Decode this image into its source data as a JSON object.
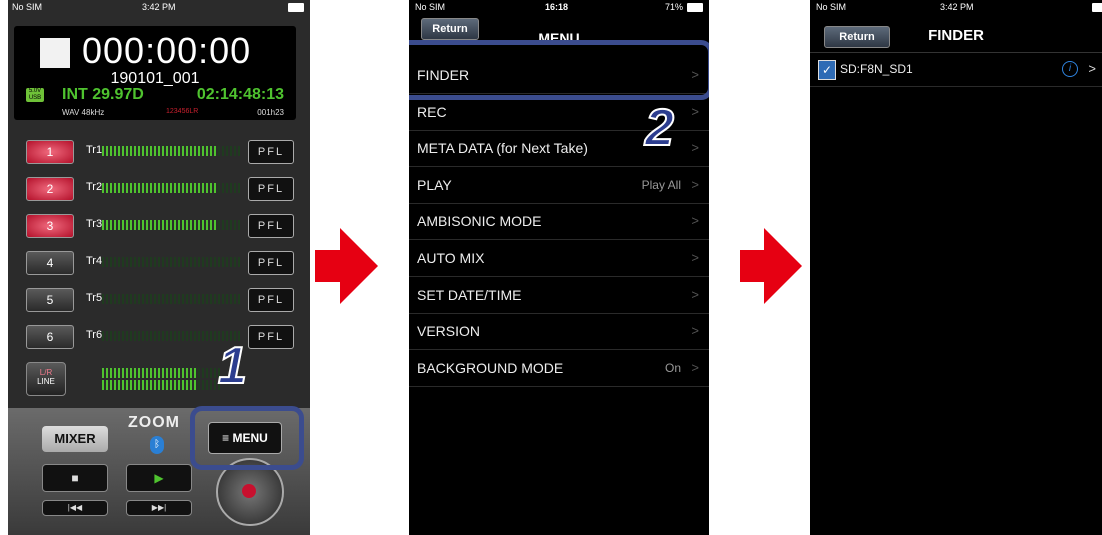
{
  "colors": {
    "arrow": "#e60012",
    "callout": "#3b4c8e",
    "meter_green": "#4fc32f",
    "rec_red": "#c8102e"
  },
  "panel1": {
    "status": {
      "carrier": "No SIM",
      "time": "3:42 PM"
    },
    "display": {
      "timecode": "000:00:00",
      "take_name": "190101_001",
      "usb_label": "5.0V USB",
      "tc_info": "INT 29.97D",
      "tc_time": "02:14:48:13",
      "format": "WAV 48kHz",
      "tracks_indicator": "123456LR",
      "remaining": "001h23"
    },
    "tracks": [
      {
        "button": "1",
        "name": "Tr1",
        "pfl": "PFL",
        "armed": true,
        "level": 0.82
      },
      {
        "button": "2",
        "name": "Tr2",
        "pfl": "PFL",
        "armed": true,
        "level": 0.82
      },
      {
        "button": "3",
        "name": "Tr3",
        "pfl": "PFL",
        "armed": true,
        "level": 0.82
      },
      {
        "button": "4",
        "name": "Tr4",
        "pfl": "PFL",
        "armed": false,
        "level": 0
      },
      {
        "button": "5",
        "name": "Tr5",
        "pfl": "PFL",
        "armed": false,
        "level": 0
      },
      {
        "button": "6",
        "name": "Tr6",
        "pfl": "PFL",
        "armed": false,
        "level": 0
      }
    ],
    "lr_button": {
      "top": "L/R",
      "bottom": "LINE"
    },
    "mixer_label": "MIXER",
    "menu_label": "≡ MENU",
    "brand": "ZOOM",
    "stop_icon": "stop-icon",
    "play_icon": "play-icon",
    "step_number": "1"
  },
  "panel2": {
    "status": {
      "carrier": "No SIM",
      "time": "16:18",
      "battery": "71%"
    },
    "return_label": "Return",
    "title": "MENU",
    "items": [
      {
        "label": "FINDER",
        "value": ""
      },
      {
        "label": "REC",
        "value": ""
      },
      {
        "label": "META DATA (for Next Take)",
        "value": ""
      },
      {
        "label": "PLAY",
        "value": "Play All"
      },
      {
        "label": "AMBISONIC MODE",
        "value": ""
      },
      {
        "label": "AUTO MIX",
        "value": ""
      },
      {
        "label": "SET DATE/TIME",
        "value": ""
      },
      {
        "label": "VERSION",
        "value": ""
      },
      {
        "label": "BACKGROUND MODE",
        "value": "On"
      }
    ],
    "chevron": ">",
    "step_number": "2"
  },
  "panel3": {
    "status": {
      "carrier": "No SIM",
      "time": "3:42 PM"
    },
    "return_label": "Return",
    "title": "FINDER",
    "item_label": "SD:F8N_SD1",
    "info_glyph": "i",
    "chevron": ">"
  }
}
